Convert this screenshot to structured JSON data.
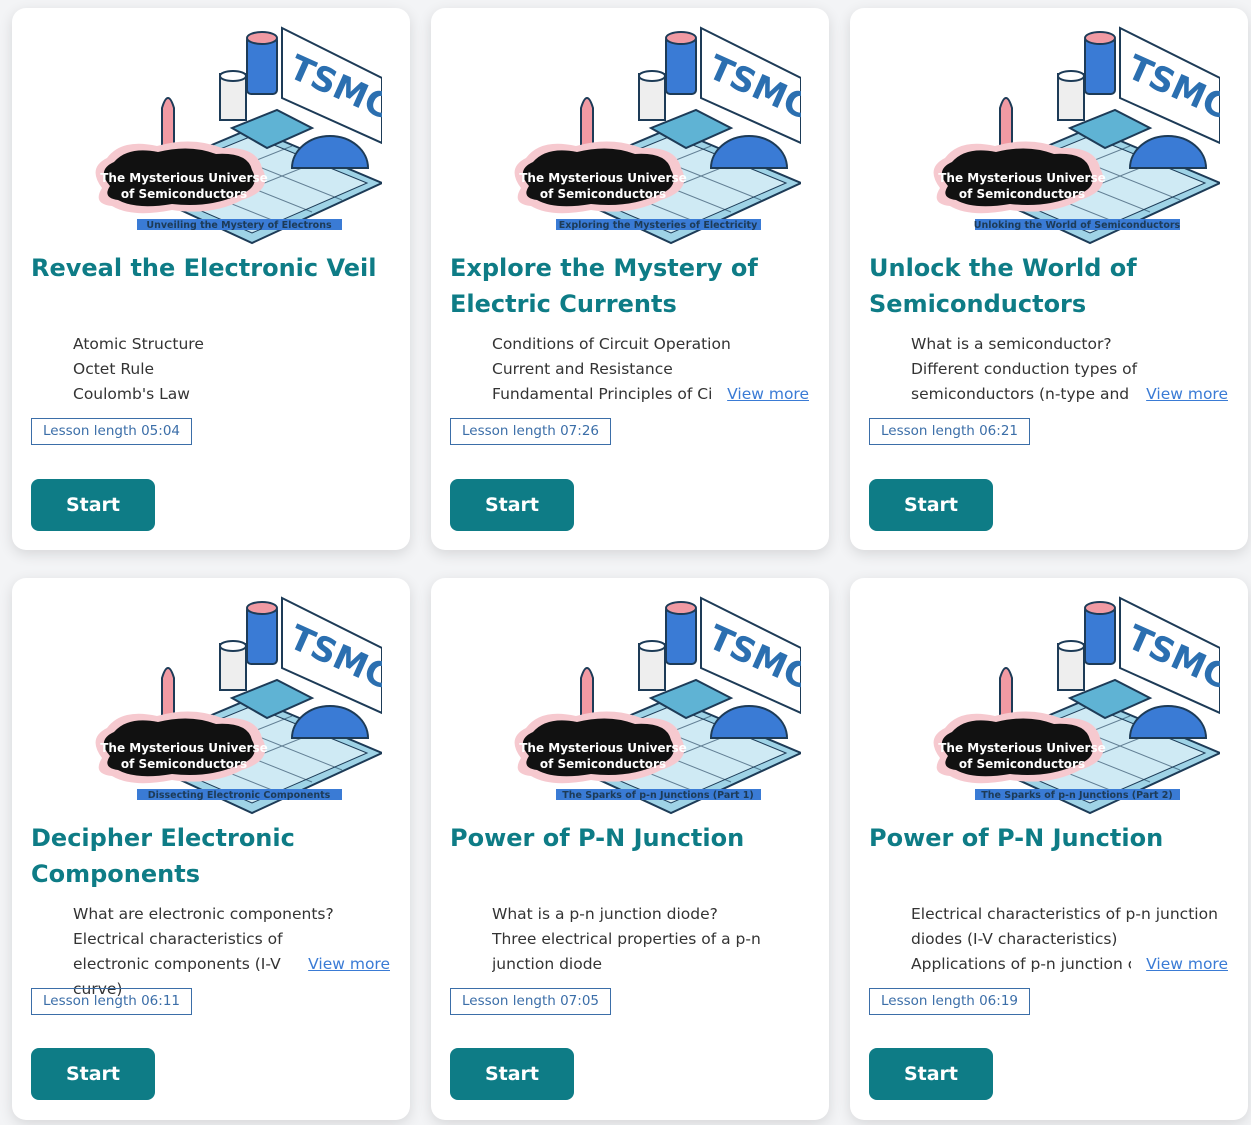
{
  "brand": {
    "sign_text": "TSMC",
    "series_title_line1": "The Mysterious Universe",
    "series_title_line2": "of Semiconductors",
    "accent": "#0e7c86"
  },
  "view_more_label": "View more",
  "start_label": "Start",
  "cards": [
    {
      "thumb_subtitle": "Unveiling the Mystery of Electrons",
      "title": "Reveal the Electronic Veil",
      "topics": [
        "Atomic Structure",
        "Octet Rule",
        "Coulomb's Law"
      ],
      "length": "Lesson length 05:04"
    },
    {
      "thumb_subtitle": "Exploring the Mysteries of Electricity",
      "title": "Explore the Mystery of Electric Currents",
      "topics": [
        "Conditions of Circuit Operation",
        "Current and Resistance",
        "Fundamental Principles of Ci"
      ],
      "length": "Lesson length 07:26"
    },
    {
      "thumb_subtitle": "Unloking the World of Semiconductors",
      "title": "Unlock the World of Semiconductors",
      "topics": [
        "What is a semiconductor?",
        "Different conduction types of semiconductors (n-type and"
      ],
      "length": "Lesson length 06:21"
    },
    {
      "thumb_subtitle": "Dissecting Electronic Components",
      "title": "Decipher Electronic Components",
      "topics": [
        "What are electronic components?",
        "Electrical characteristics of electronic components (I-V curve)"
      ],
      "length": "Lesson length 06:11"
    },
    {
      "thumb_subtitle": "The Sparks of p-n Junctions (Part 1)",
      "title": "Power of P-N Junction",
      "topics": [
        "What is a p-n junction diode?",
        "Three electrical properties of a p-n junction diode"
      ],
      "length": "Lesson length 07:05"
    },
    {
      "thumb_subtitle": "The Sparks of p-n Junctions (Part 2)",
      "title": "Power of P-N Junction",
      "topics": [
        "Electrical characteristics of p-n junction diodes (I-V characteristics)",
        "Applications of p-n junction c"
      ],
      "length": "Lesson length 06:19"
    }
  ]
}
